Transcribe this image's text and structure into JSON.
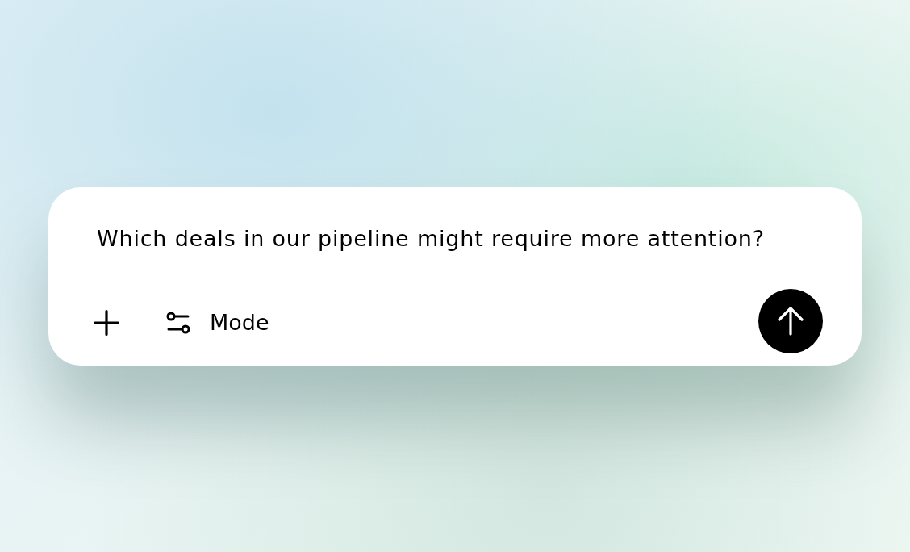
{
  "composer": {
    "input": {
      "value": "Which deals in our pipeline might require more attention?"
    },
    "mode_button": {
      "label": "Mode"
    }
  }
}
